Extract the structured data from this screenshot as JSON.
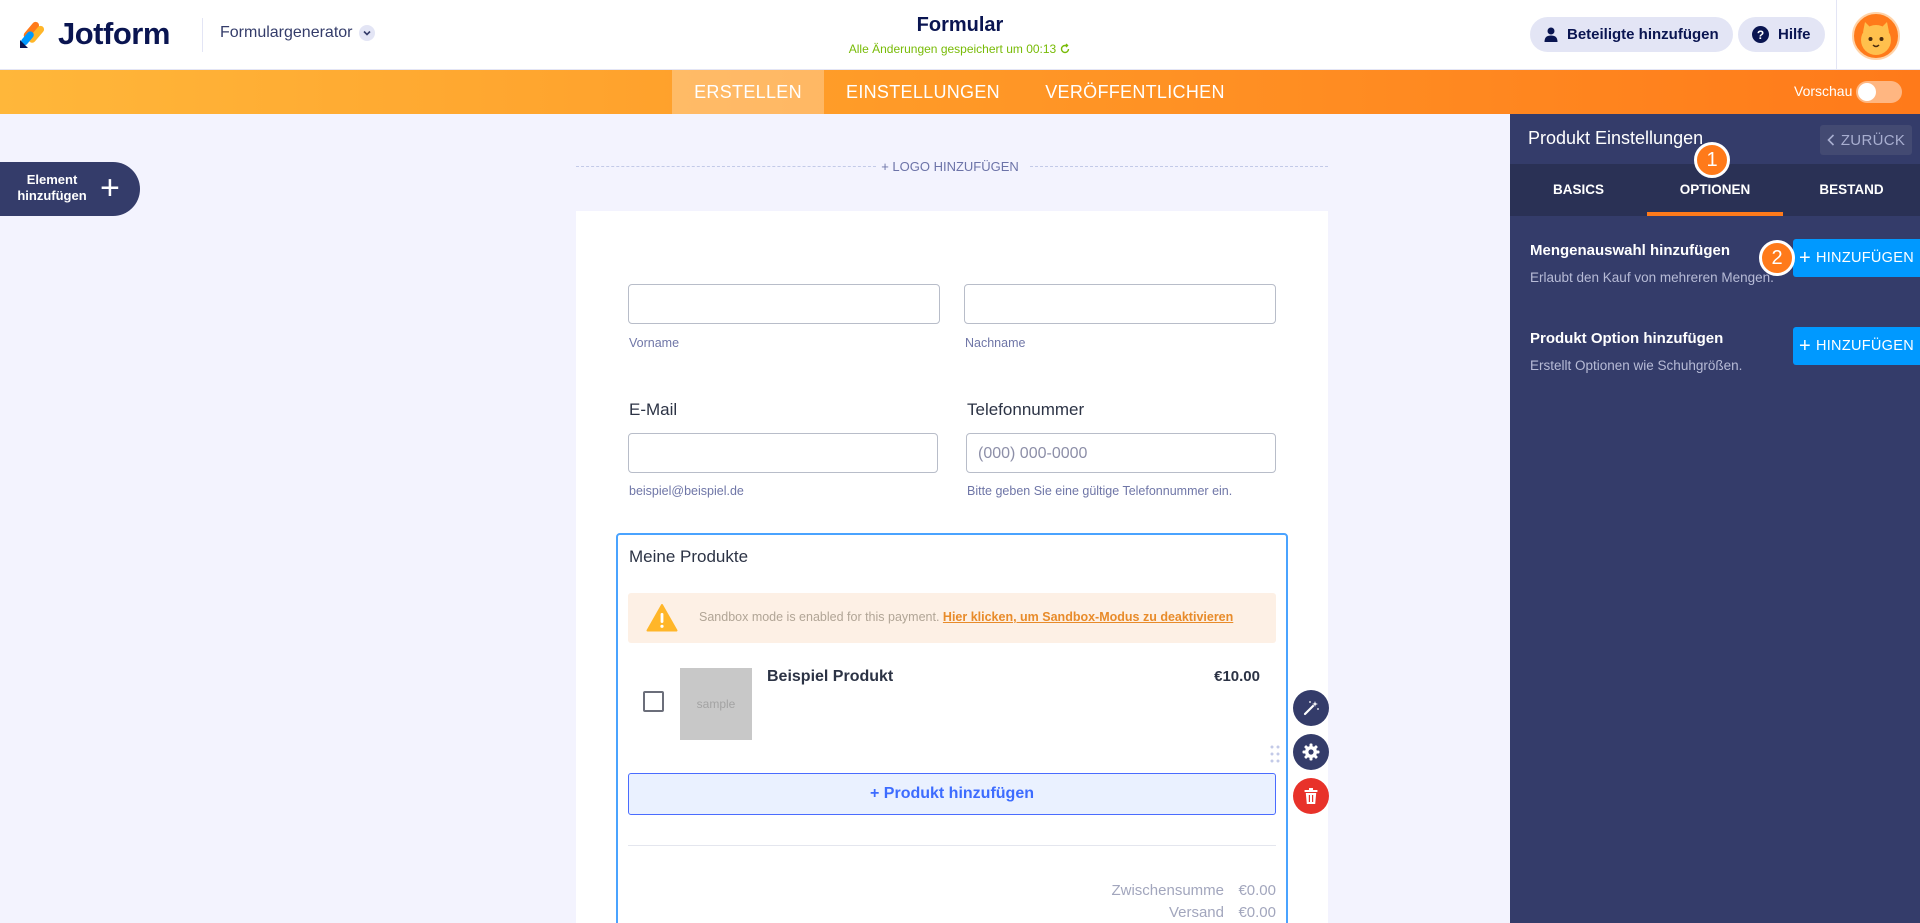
{
  "header": {
    "brand": "Jotform",
    "form_builder": "Formulargenerator",
    "form_title": "Formular",
    "saved_status": "Alle Änderungen gespeichert um 00:13",
    "invite_label": "Beteiligte hinzufügen",
    "help_label": "Hilfe"
  },
  "nav": {
    "tabs": [
      {
        "label": "ERSTELLEN",
        "active": true
      },
      {
        "label": "EINSTELLUNGEN",
        "active": false
      },
      {
        "label": "VERÖFFENTLICHEN",
        "active": false
      }
    ],
    "preview_label": "Vorschau",
    "preview_on": false
  },
  "builder": {
    "add_element_label": "Element hinzufügen",
    "add_logo_label": "+ LOGO HINZUFÜGEN"
  },
  "form": {
    "first_name_sublabel": "Vorname",
    "last_name_sublabel": "Nachname",
    "email_label": "E-Mail",
    "email_sublabel": "beispiel@beispiel.de",
    "phone_label": "Telefonnummer",
    "phone_placeholder": "(000) 000-0000",
    "phone_sublabel": "Bitte geben Sie eine gültige Telefonnummer ein.",
    "products": {
      "title": "Meine Produkte",
      "sandbox_text": "Sandbox mode is enabled for this payment.",
      "sandbox_link": "Hier klicken, um Sandbox-Modus zu deaktivieren",
      "items": [
        {
          "image_text": "sample",
          "name": "Beispiel Produkt",
          "price": "€10.00",
          "checked": false
        }
      ],
      "add_product_label": "+ Produkt hinzufügen",
      "totals": [
        {
          "label": "Zwischensumme",
          "value": "€0.00"
        },
        {
          "label": "Versand",
          "value": "€0.00"
        }
      ]
    }
  },
  "panel": {
    "title": "Produkt Einstellungen",
    "back_label": "ZURÜCK",
    "tabs": [
      {
        "label": "BASICS",
        "active": false
      },
      {
        "label": "OPTIONEN",
        "active": true
      },
      {
        "label": "BESTAND",
        "active": false
      }
    ],
    "options": [
      {
        "title": "Mengenauswahl hinzufügen",
        "description": "Erlaubt den Kauf von mehreren Mengen.",
        "button": "HINZUFÜGEN"
      },
      {
        "title": "Produkt Option hinzufügen",
        "description": "Erstellt Optionen wie Schuhgrößen.",
        "button": "HINZUFÜGEN"
      }
    ]
  },
  "callouts": [
    "1",
    "2"
  ],
  "colors": {
    "accent_orange": "#ff7a1a",
    "navy": "#0a1551",
    "panel_bg": "#343c6a",
    "add_blue": "#0099ff",
    "saved_green": "#78bb07",
    "delete_red": "#e8322a"
  },
  "icons": [
    "jotform-logo-icon",
    "chevron-down-icon",
    "refresh-icon",
    "user-icon",
    "help-icon",
    "avatar-icon",
    "plus-icon",
    "warning-icon",
    "magic-wand-icon",
    "gear-icon",
    "trash-icon",
    "drag-handle-icon",
    "chevron-left-icon"
  ]
}
